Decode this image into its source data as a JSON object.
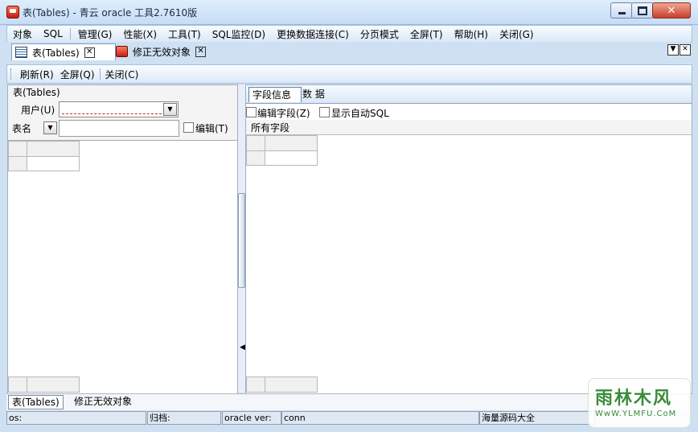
{
  "window": {
    "title": "表(Tables) - 青云 oracle 工具2.7610版",
    "minimize_symbol": "",
    "close_symbol": "✕"
  },
  "menu": {
    "items": [
      "对象",
      "SQL",
      "管理(G)",
      "性能(X)",
      "工具(T)",
      "SQL监控(D)",
      "更换数据连接(C)",
      "分页模式",
      "全屏(T)",
      "帮助(H)",
      "关闭(G)"
    ]
  },
  "doc_tabs": {
    "items": [
      {
        "label": "表(Tables)",
        "close": "✕"
      },
      {
        "label": "修正无效对象",
        "close": "✕"
      }
    ],
    "dropdown_symbol": "▼",
    "close_symbol": "✕"
  },
  "toolbar": {
    "refresh": "刷新(R)",
    "fullscreen": "全屏(Q)",
    "close": "关闭(C)"
  },
  "left": {
    "group_title": "表(Tables)",
    "user_label": "用户(U)",
    "user_value": "",
    "table_name_label": "表名",
    "table_name_value": "",
    "edit_label": "编辑(T)",
    "combo_arrow": "▼"
  },
  "splitter": {
    "arrow": "◀"
  },
  "right": {
    "tabs": [
      "字段信息",
      "数 据"
    ],
    "edit_field_label": "编辑字段(Z)",
    "auto_sql_label": "显示自动SQL",
    "all_fields_label": "所有字段"
  },
  "bottom_tabs": [
    "表(Tables)",
    "修正无效对象"
  ],
  "status": {
    "os": "os:",
    "archive": "归档:",
    "oracle_ver": "oracle ver:",
    "conn": "conn",
    "extra": "海量源码大全"
  },
  "watermark": {
    "logo": "雨林木风",
    "url": "WwW.YLMFU.CoM"
  }
}
